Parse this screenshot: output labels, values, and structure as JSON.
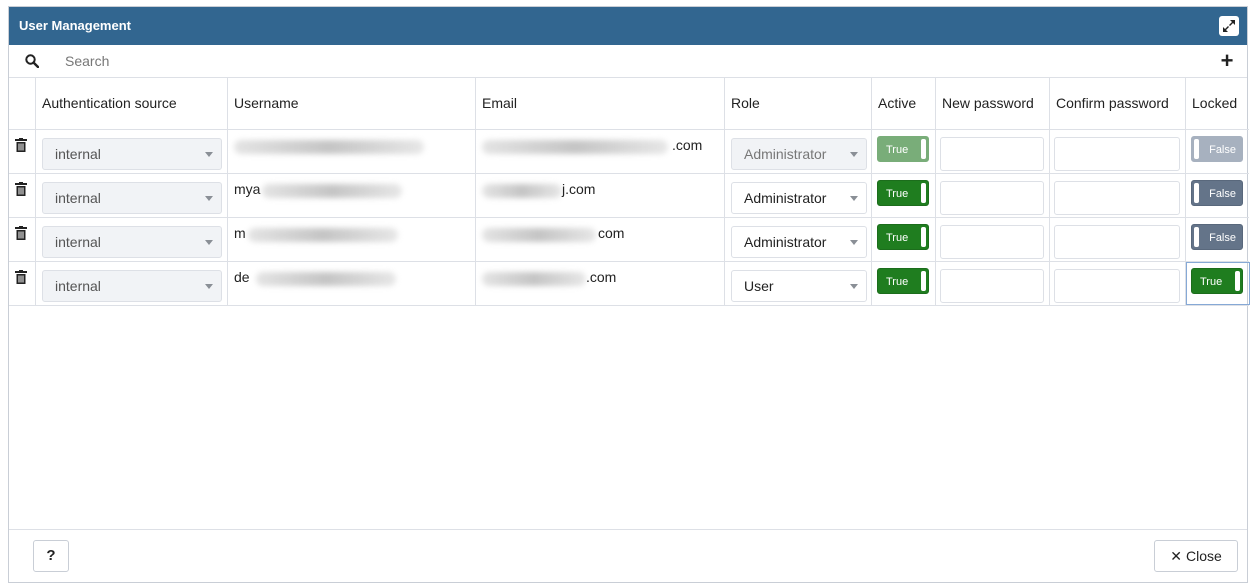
{
  "dialog": {
    "title": "User Management"
  },
  "search": {
    "placeholder": "Search",
    "value": ""
  },
  "columns": [
    "Authentication source",
    "Username",
    "Email",
    "Role",
    "Active",
    "New password",
    "Confirm password",
    "Locked"
  ],
  "rows": [
    {
      "auth_source": "internal",
      "username": "",
      "email": ".com",
      "role": "Administrator",
      "role_disabled": true,
      "active": "True",
      "active_disabled": true,
      "locked": "False",
      "locked_disabled": true
    },
    {
      "auth_source": "internal",
      "username": "mya",
      "email": "j.com",
      "role": "Administrator",
      "role_disabled": false,
      "active": "True",
      "active_disabled": false,
      "locked": "False",
      "locked_disabled": false
    },
    {
      "auth_source": "internal",
      "username": "m",
      "email": "com",
      "role": "Administrator",
      "role_disabled": false,
      "active": "True",
      "active_disabled": false,
      "locked": "False",
      "locked_disabled": false
    },
    {
      "auth_source": "internal",
      "username": "de",
      "email": ".com",
      "role": "User",
      "role_disabled": false,
      "active": "True",
      "active_disabled": false,
      "locked": "True",
      "locked_disabled": false
    }
  ],
  "footer": {
    "help_label": "?",
    "close_label": "Close"
  },
  "colors": {
    "titlebar": "#326690",
    "toggle_on": "#1f7d1f",
    "toggle_off": "#647489"
  },
  "icons": {
    "search": "search-icon",
    "add": "plus-icon",
    "delete": "trash-icon",
    "maximize": "expand-icon",
    "close": "x-icon"
  }
}
